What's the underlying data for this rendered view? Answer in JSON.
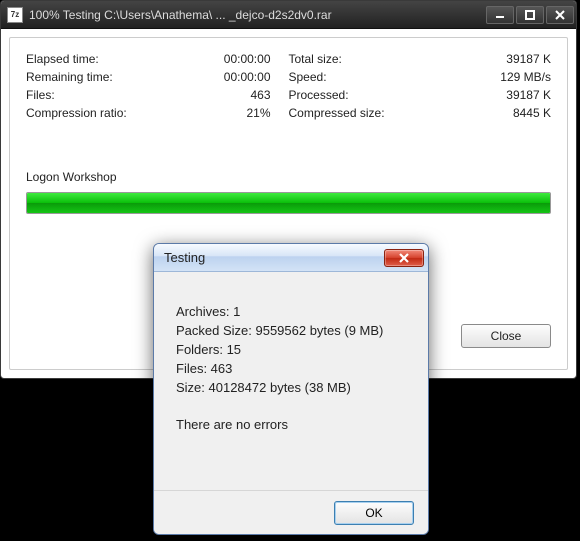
{
  "main": {
    "app_icon_text": "7z",
    "title": "100% Testing C:\\Users\\Anathema\\ ... _dejco-d2s2dv0.rar",
    "stats_left": [
      {
        "label": "Elapsed time:",
        "value": "00:00:00"
      },
      {
        "label": "Remaining time:",
        "value": "00:00:00"
      },
      {
        "label": "Files:",
        "value": "463"
      },
      {
        "label": "Compression ratio:",
        "value": "21%"
      }
    ],
    "stats_right": [
      {
        "label": "Total size:",
        "value": "39187 K"
      },
      {
        "label": "Speed:",
        "value": "129 MB/s"
      },
      {
        "label": "Processed:",
        "value": "39187 K"
      },
      {
        "label": "Compressed size:",
        "value": "8445 K"
      }
    ],
    "current_file": "Logon Workshop",
    "close_label": "Close"
  },
  "dialog": {
    "title": "Testing",
    "lines": {
      "archives": "Archives: 1",
      "packed": "Packed Size: 9559562 bytes (9 MB)",
      "folders": "Folders: 15",
      "files": "Files: 463",
      "size": "Size: 40128472 bytes (38 MB)"
    },
    "message": "There are no errors",
    "ok_label": "OK"
  }
}
